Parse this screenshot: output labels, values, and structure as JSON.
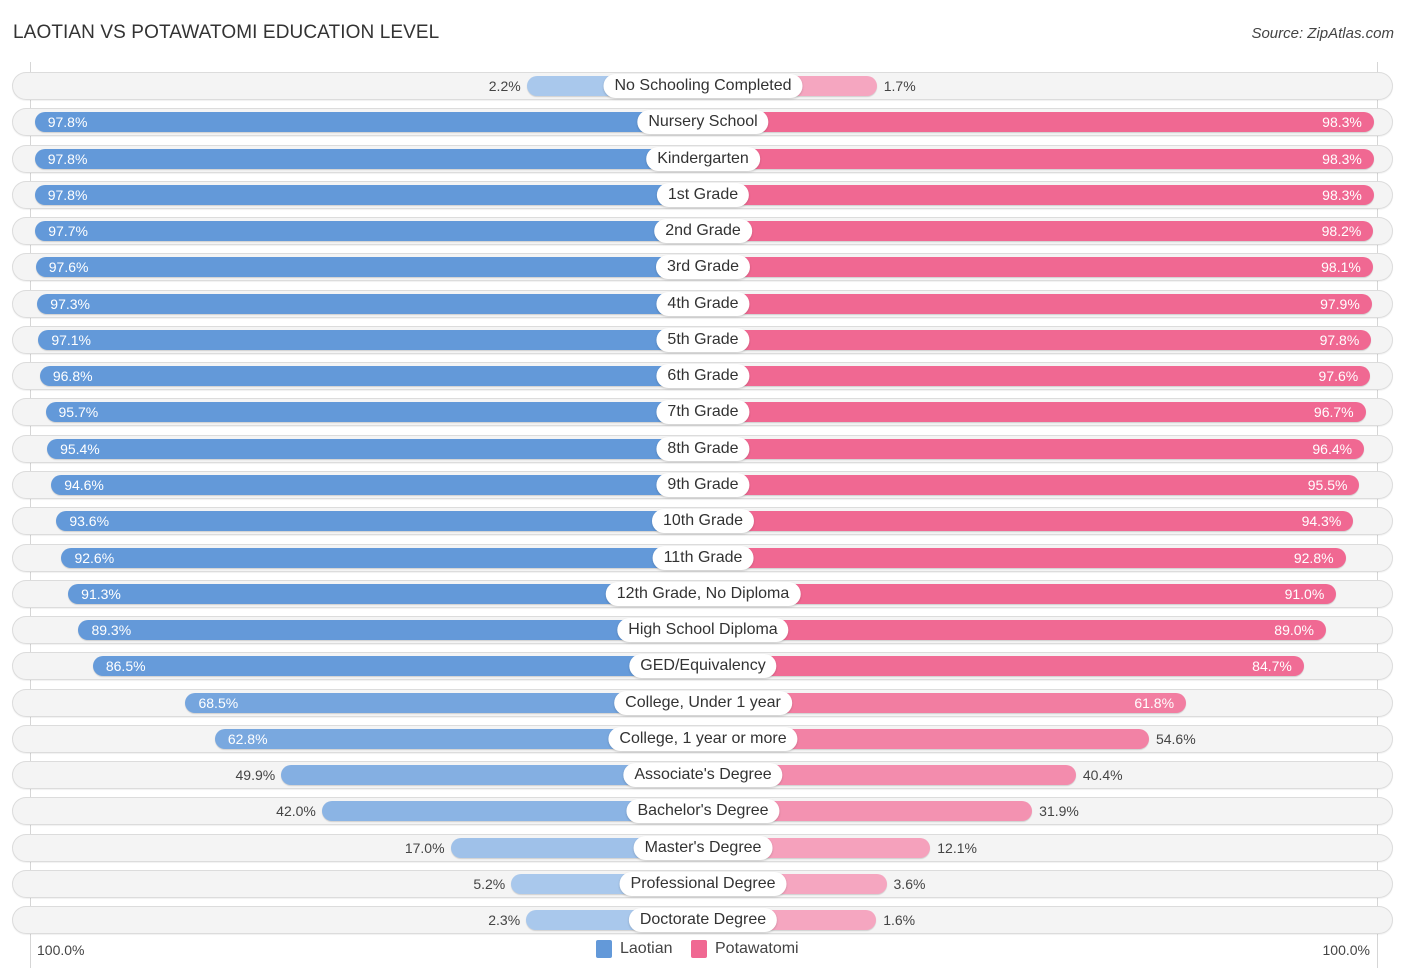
{
  "header": {
    "title": "LAOTIAN VS POTAWATOMI EDUCATION LEVEL",
    "source": "Source: ZipAtlas.com"
  },
  "colors": {
    "laotian": "#6399d9",
    "laotian_light": "#a9c8ec",
    "potawatomi": "#f06892",
    "potawatomi_light": "#f5a6c0"
  },
  "chart_data": {
    "type": "bar",
    "title": "LAOTIAN VS POTAWATOMI EDUCATION LEVEL",
    "orientation": "horizontal-diverging",
    "xlabel": "",
    "ylabel": "",
    "xlim": [
      0,
      100
    ],
    "axis_labels": {
      "left": "100.0%",
      "right": "100.0%"
    },
    "legend": {
      "position": "bottom-center",
      "entries": [
        "Laotian",
        "Potawatomi"
      ]
    },
    "categories": [
      "No Schooling Completed",
      "Nursery School",
      "Kindergarten",
      "1st Grade",
      "2nd Grade",
      "3rd Grade",
      "4th Grade",
      "5th Grade",
      "6th Grade",
      "7th Grade",
      "8th Grade",
      "9th Grade",
      "10th Grade",
      "11th Grade",
      "12th Grade, No Diploma",
      "High School Diploma",
      "GED/Equivalency",
      "College, Under 1 year",
      "College, 1 year or more",
      "Associate's Degree",
      "Bachelor's Degree",
      "Master's Degree",
      "Professional Degree",
      "Doctorate Degree"
    ],
    "series": [
      {
        "name": "Laotian",
        "side": "left",
        "values": [
          2.2,
          97.8,
          97.8,
          97.8,
          97.7,
          97.6,
          97.3,
          97.1,
          96.8,
          95.7,
          95.4,
          94.6,
          93.6,
          92.6,
          91.3,
          89.3,
          86.5,
          68.5,
          62.8,
          49.9,
          42.0,
          17.0,
          5.2,
          2.3
        ]
      },
      {
        "name": "Potawatomi",
        "side": "right",
        "values": [
          1.7,
          98.3,
          98.3,
          98.3,
          98.2,
          98.1,
          97.9,
          97.8,
          97.6,
          96.7,
          96.4,
          95.5,
          94.3,
          92.8,
          91.0,
          89.0,
          84.7,
          61.8,
          54.6,
          40.4,
          31.9,
          12.1,
          3.6,
          1.6
        ]
      }
    ],
    "value_suffix": "%"
  }
}
